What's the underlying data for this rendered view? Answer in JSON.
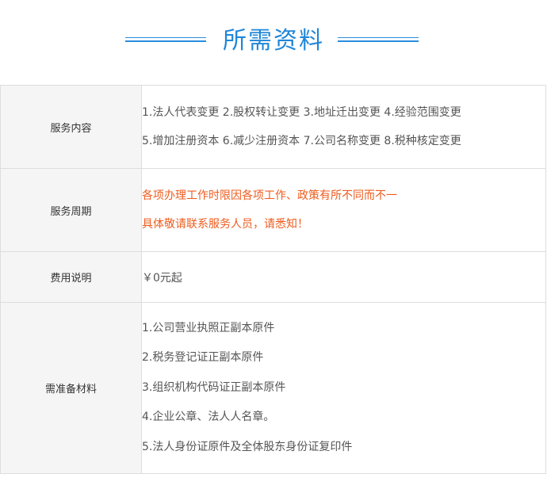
{
  "header": {
    "title": "所需资料"
  },
  "rows": [
    {
      "label": "服务内容",
      "lines": [
        "1.法人代表变更  2.股权转让变更  3.地址迁出变更  4.经验范围变更",
        "5.增加注册资本  6.减少注册资本  7.公司名称变更  8.税种核定变更"
      ]
    },
    {
      "label": "服务周期",
      "lines": [
        "各项办理工作时限因各项工作、政策有所不同而不一",
        "具体敬请联系服务人员，请悉知！"
      ]
    },
    {
      "label": "费用说明",
      "lines": [
        "￥0元起"
      ]
    },
    {
      "label": "需准备材料",
      "lines": [
        "1.公司营业执照正副本原件",
        "2.税务登记证正副本原件",
        "3.组织机构代码证正副本原件",
        "4.企业公章、法人人名章。",
        "5.法人身份证原件及全体股东身份证复印件"
      ]
    }
  ],
  "colors": {
    "title": "#1f86d8",
    "highlight_text": "#ee5c1e",
    "label_background": "#f5f5f5",
    "border": "#dddddd"
  }
}
